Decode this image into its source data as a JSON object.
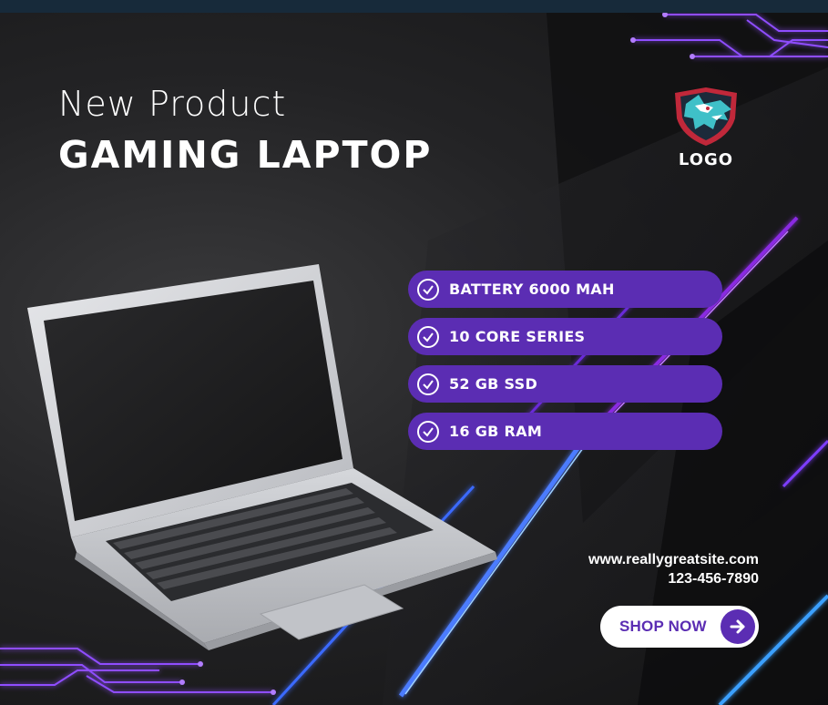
{
  "poster": {
    "title_small": "New Product",
    "title_big": "GAMING LAPTOP",
    "logo_text": "LOGO",
    "features": [
      {
        "label": "BATTERY 6000 MAH",
        "icon": "check-circle-icon"
      },
      {
        "label": "10 CORE SERIES",
        "icon": "check-circle-icon"
      },
      {
        "label": "52 GB SSD",
        "icon": "check-circle-icon"
      },
      {
        "label": "16 GB RAM",
        "icon": "check-circle-icon"
      }
    ],
    "website": "www.reallygreatsite.com",
    "phone": "123-456-7890",
    "cta_label": "SHOP NOW",
    "cta_icon": "arrow-right-icon"
  },
  "colors": {
    "background": "#1c1c1e",
    "accent_purple": "#5b2db3",
    "neon_purple": "#8a2be2",
    "neon_blue": "#3aa0ff",
    "text": "#ffffff"
  }
}
